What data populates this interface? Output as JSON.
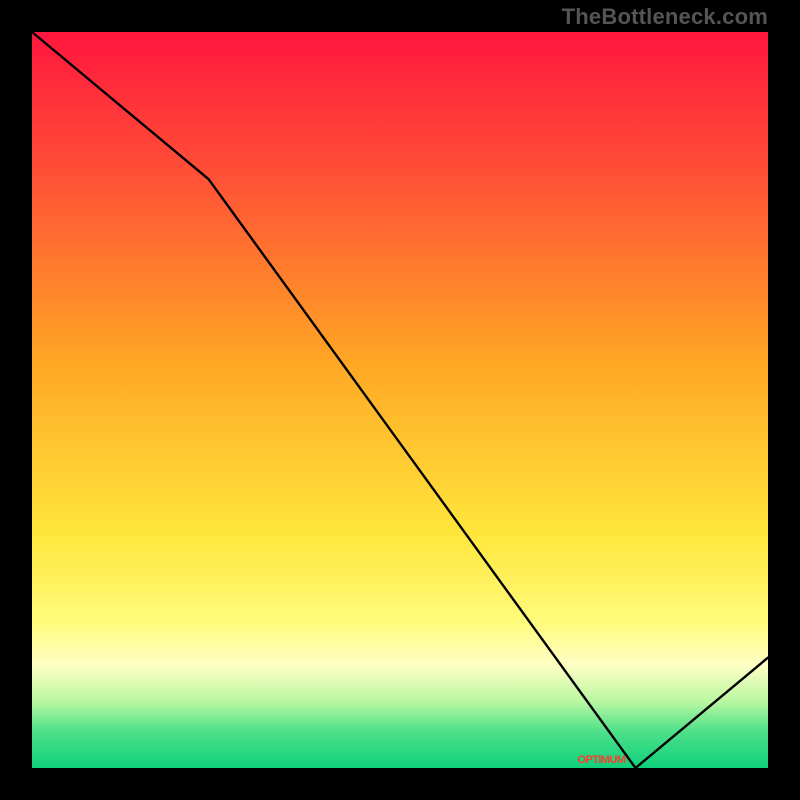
{
  "watermark": "TheBottleneck.com",
  "chart_data": {
    "type": "line",
    "title": "",
    "xlabel": "",
    "ylabel": "",
    "xlim": [
      0,
      100
    ],
    "ylim": [
      0,
      100
    ],
    "x": [
      0,
      24,
      82,
      100
    ],
    "values": [
      100,
      80,
      0,
      15
    ],
    "grid": false,
    "legend": false,
    "background_gradient_stops": [
      {
        "pct": 0,
        "color": "#ff163e"
      },
      {
        "pct": 20,
        "color": "#ff5236"
      },
      {
        "pct": 45,
        "color": "#ffa724"
      },
      {
        "pct": 68,
        "color": "#ffe63b"
      },
      {
        "pct": 80,
        "color": "#fffb7a"
      },
      {
        "pct": 86,
        "color": "#ffffc5"
      },
      {
        "pct": 91,
        "color": "#b9f7a1"
      },
      {
        "pct": 95,
        "color": "#4fe08a"
      },
      {
        "pct": 100,
        "color": "#0fd07b"
      }
    ],
    "x_marker_label": "OPTIMUM"
  },
  "colors": {
    "line": "#000000",
    "label": "#ff3a2f"
  }
}
